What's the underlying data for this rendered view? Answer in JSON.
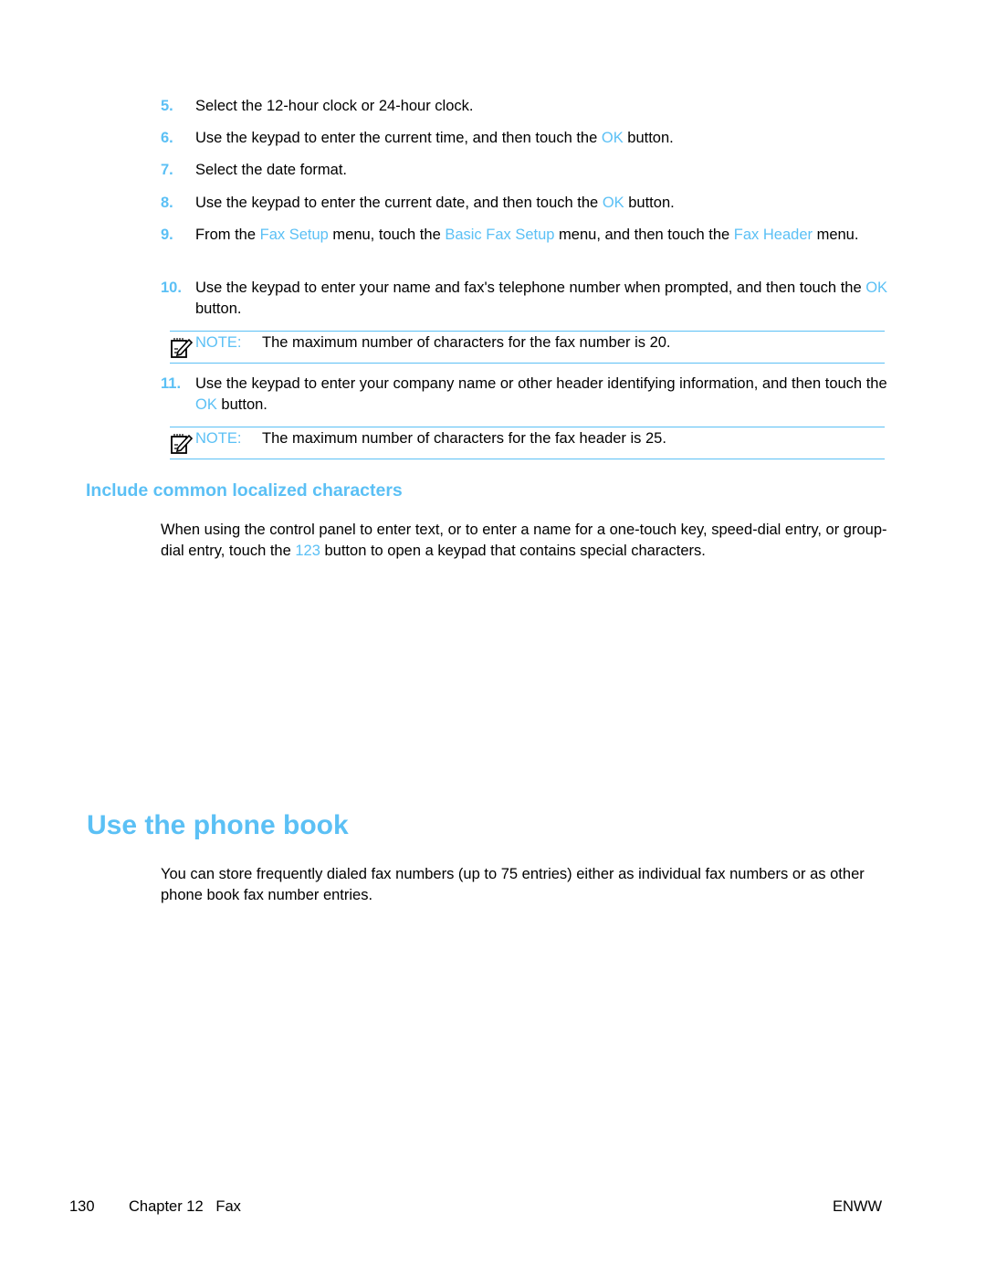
{
  "accent_color": "#5bc0f5",
  "steps": [
    {
      "num": "5.",
      "parts": [
        "Select the 12-hour clock or 24-hour clock."
      ]
    },
    {
      "num": "6.",
      "parts": [
        "Use the keypad to enter the current time, and then touch the ",
        "OK",
        " button."
      ]
    },
    {
      "num": "7.",
      "parts": [
        "Select the date format."
      ]
    },
    {
      "num": "8.",
      "parts": [
        "Use the keypad to enter the current date, and then touch the ",
        "OK",
        " button."
      ]
    },
    {
      "num": "9.",
      "parts": [
        "From the ",
        "Fax Setup",
        " menu, touch the ",
        "Basic Fax Setup",
        " menu, and then touch the ",
        "Fax Header",
        " menu."
      ]
    },
    {
      "num": "10.",
      "parts": [
        "Use the keypad to enter your name and fax's telephone number when prompted, and then touch the ",
        "OK",
        " button."
      ]
    },
    {
      "num": "11.",
      "parts": [
        "Use the keypad to enter your company name or other header identifying information, and then touch the ",
        "OK",
        " button."
      ]
    }
  ],
  "notes": [
    {
      "label": "NOTE:",
      "text": "The maximum number of characters for the fax number is 20."
    },
    {
      "label": "NOTE:",
      "text": "The maximum number of characters for the fax header is 25."
    }
  ],
  "section": {
    "heading": "Include common localized characters",
    "para_parts": [
      "When using the control panel to enter text, or to enter a name for a one-touch key, speed-dial entry, or group-dial entry, touch the ",
      "123",
      " button to open a keypad that contains special characters."
    ]
  },
  "chapter_section": {
    "heading": "Use the phone book",
    "para": "You can store frequently dialed fax numbers (up to 75 entries) either as individual fax numbers or as other phone book fax number entries."
  },
  "footer": {
    "page_number": "130",
    "chapter": "Chapter 12   Fax",
    "locale": "ENWW"
  }
}
